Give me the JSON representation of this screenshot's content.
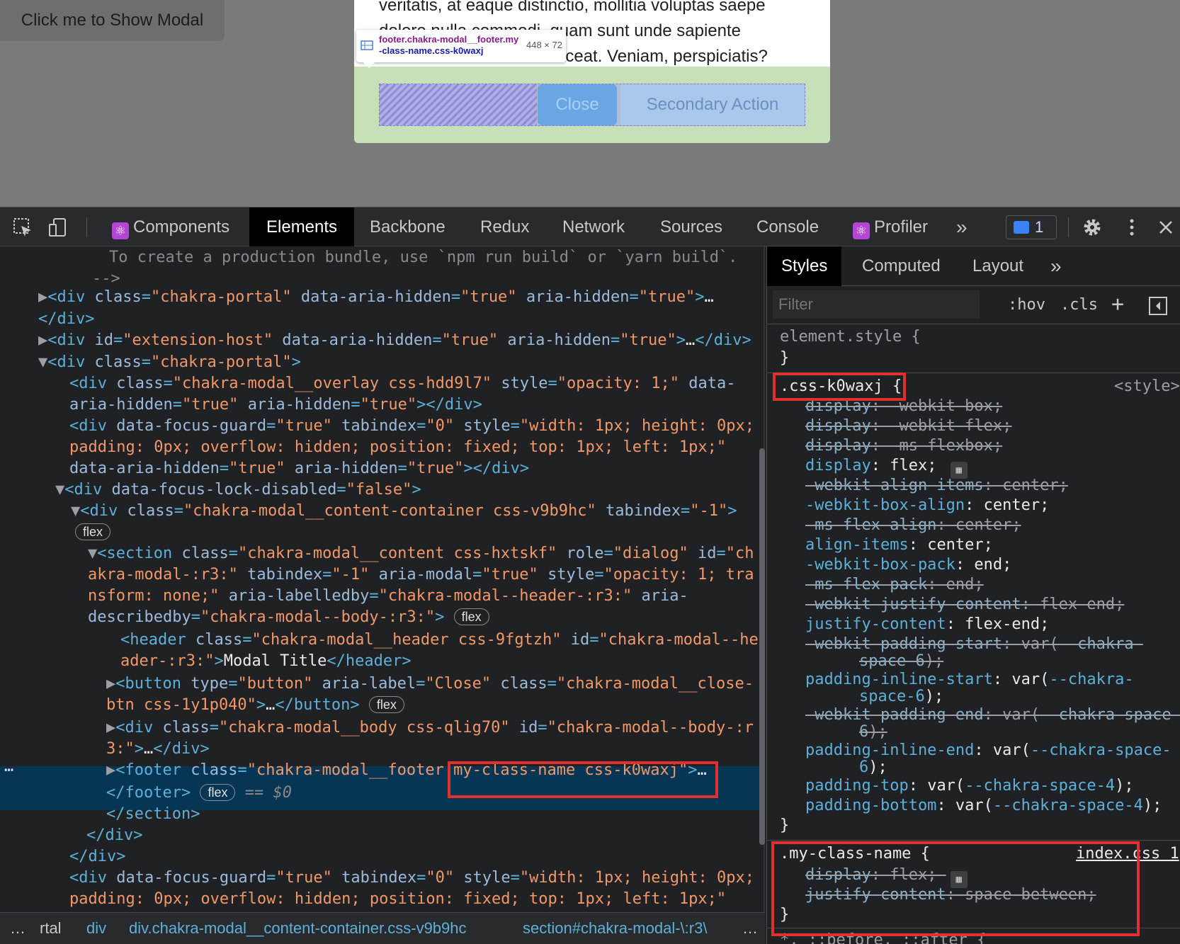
{
  "page": {
    "show_modal_button": "Click me to Show Modal",
    "modal_text": [
      "veritatis, at eaque distinctio, mollitia voluptas saepe",
      "dolore nulla commodi, quam sunt unde sapiente",
      "aceat. Veniam, perspiciatis?"
    ],
    "close_button": "Close",
    "secondary_button": "Secondary Action",
    "tooltip": {
      "element": "footer",
      "classes": ".chakra-modal__footer.my-class-name.css-k0waxj",
      "line1": "footer.chakra-modal__footer.my",
      "line2": "-class-name.css-k0waxj",
      "dims": "448 × 72"
    }
  },
  "devtools": {
    "tabs": [
      "Components",
      "Elements",
      "Backbone",
      "Redux",
      "Network",
      "Sources",
      "Console",
      "Profiler"
    ],
    "more": "»",
    "issues_count": "1",
    "styles_tabs": [
      "Styles",
      "Computed",
      "Layout"
    ],
    "filter_placeholder": "Filter",
    "hov": ":hov",
    "cls": ".cls",
    "plus": "+",
    "selected_suffix": "== $0",
    "breadcrumbs": [
      "…",
      "rtal",
      "div",
      "div.chakra-modal__content-container.css-v9b9hc",
      "section#chakra-modal-\\:r3\\",
      "…"
    ]
  },
  "dom_lines": {
    "l0": "To create a production bundle, use `npm run build` or `yarn build`.",
    "l1": "-->",
    "l2": "chakra-portal",
    "l3": "extension-host",
    "l4": "chakra-portal",
    "l5": "chakra-modal__overlay css-hdd9l7",
    "l7": "Modal Title",
    "flex": "flex"
  },
  "styles": {
    "element_style": "element.style {",
    "close_brace": "}",
    "rule1_selector": ".css-k0waxj {",
    "rule1_source": "<style>",
    "rule2_selector": ".my-class-name {",
    "rule2_source": "index.css 1",
    "bottom": "*, ::before, ::after {"
  },
  "colors": {
    "highlight_red": "#e0312f",
    "selected_row": "#073655",
    "footer_green": "#c7e0b8"
  }
}
